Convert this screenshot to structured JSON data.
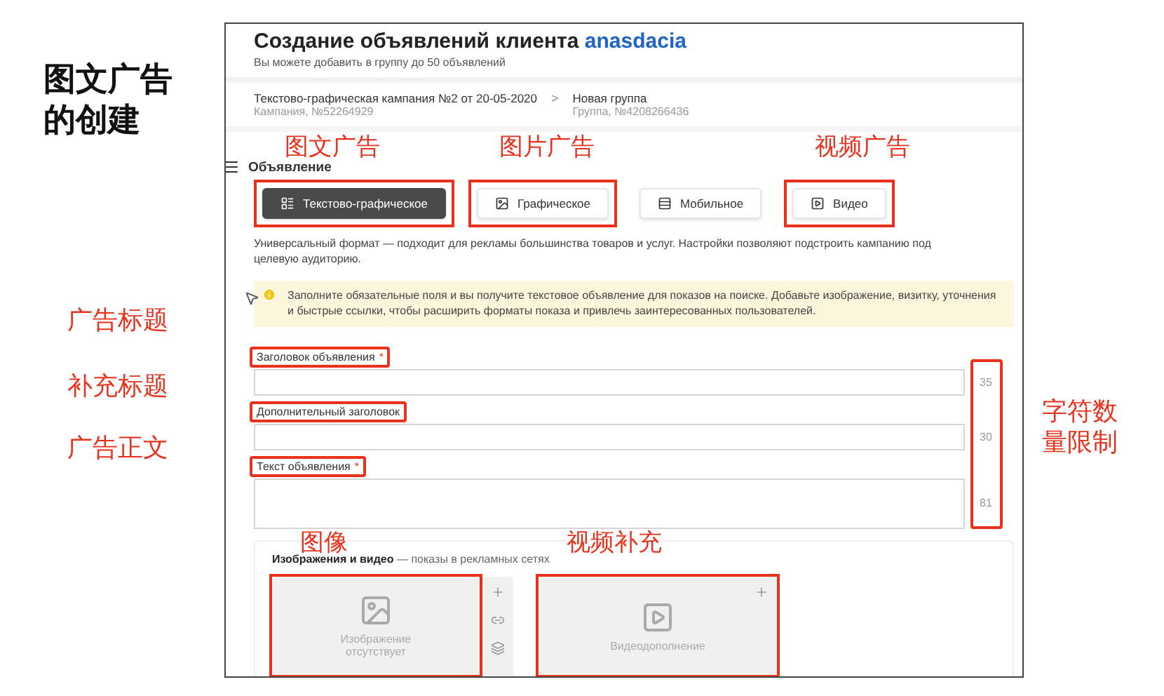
{
  "slide_title": "图文广告的创建",
  "side_labels": [
    "广告标题",
    "补充标题",
    "广告正文"
  ],
  "page": {
    "title": "Создание объявлений клиента",
    "client": "anasdacia",
    "subtitle": "Вы можете добавить в группу до 50 объявлений"
  },
  "breadcrumb": [
    {
      "name": "Текстово-графическая кампания №2 от 20-05-2020",
      "meta": "Кампания, №52264929"
    },
    {
      "name": "Новая группа",
      "meta": "Группа, №4208266436"
    }
  ],
  "breadcrumb_separator": ">",
  "section": {
    "title": "Объявление"
  },
  "ad_types": [
    {
      "kind": "text-graphic",
      "label": "Текстово-графическое",
      "selected": true,
      "highlighted": true,
      "annotation": "图文广告"
    },
    {
      "kind": "graphic",
      "label": "Графическое",
      "selected": false,
      "highlighted": true,
      "annotation": "图片广告"
    },
    {
      "kind": "mobile",
      "label": "Мобильное",
      "selected": false,
      "highlighted": false
    },
    {
      "kind": "video",
      "label": "Видео",
      "selected": false,
      "highlighted": true,
      "annotation": "视频广告"
    }
  ],
  "description": "Универсальный формат — подходит для рекламы большинства товаров и услуг. Настройки позволяют подстроить кампанию под целевую аудиторию.",
  "notice": "Заполните обязательные поля и вы получите текстовое объявление для показов на поиске. Добавьте изображение, визитку, уточнения и быстрые ссылки, чтобы расширить форматы показа и привлечь заинтересованных пользователей.",
  "fields": [
    {
      "kind": "input",
      "label": "Заголовок объявления",
      "required_mark": "*",
      "highlighted": true,
      "counter": "35"
    },
    {
      "kind": "input",
      "label": "Дополнительный заголовок",
      "highlighted": true,
      "counter": "30"
    },
    {
      "kind": "textarea",
      "label": "Текст объявления",
      "required_mark": "*",
      "highlighted": true,
      "counter": "81"
    }
  ],
  "char_limit": {
    "highlighted": true,
    "annotation": "字符数量限制"
  },
  "media": {
    "title": "Изображения и видео",
    "subtitle": "— показы в рекламных сетях",
    "cards": [
      {
        "kind": "image",
        "caption": "Изображение отсутствует",
        "highlighted": true,
        "annotation": "图像"
      },
      {
        "kind": "video",
        "caption": "Видеодополнение",
        "highlighted": true,
        "annotation": "视频补充"
      }
    ]
  }
}
